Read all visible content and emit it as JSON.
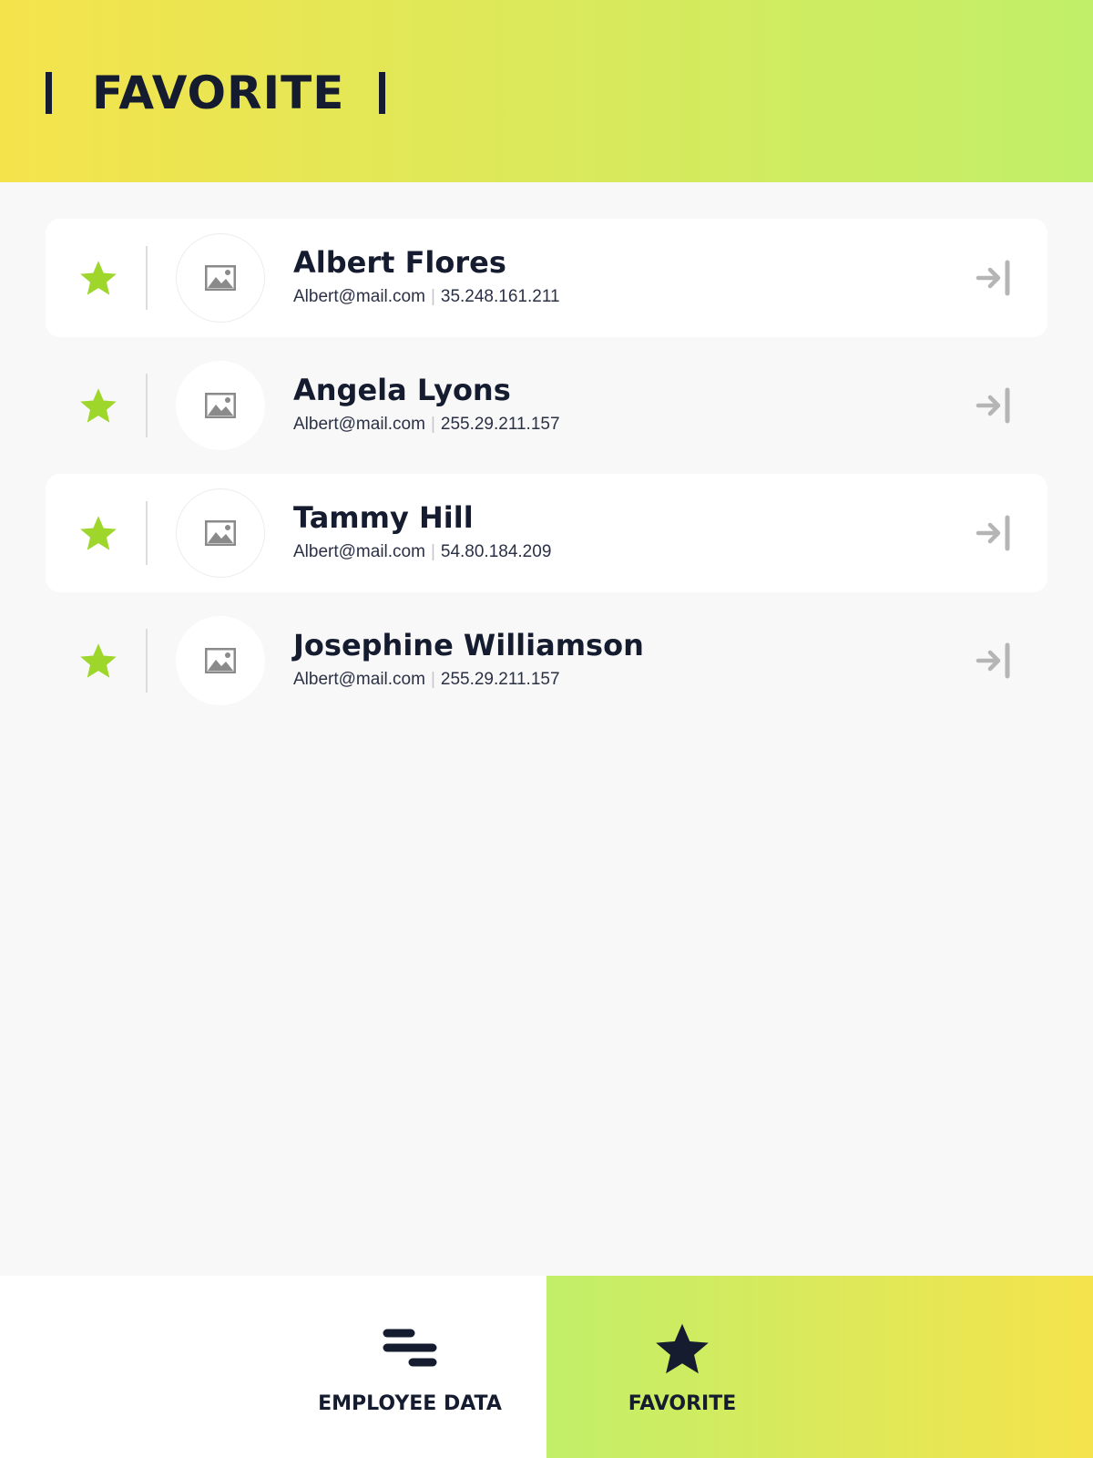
{
  "colors": {
    "accent_green": "#9ed62b",
    "dark_navy": "#151c2f",
    "header_gradient_start": "#f5e34c",
    "header_gradient_end": "#c1ef69",
    "muted_icon": "#b5b5b5"
  },
  "header": {
    "title": "FAVORITE"
  },
  "favorites": [
    {
      "name": "Albert Flores",
      "email": "Albert@mail.com",
      "ip": "35.248.161.211",
      "star_icon": "star-icon",
      "avatar_icon": "image-placeholder-icon",
      "action_icon": "arrow-right-to-bar-icon"
    },
    {
      "name": "Angela Lyons",
      "email": "Albert@mail.com",
      "ip": "255.29.211.157",
      "star_icon": "star-icon",
      "avatar_icon": "image-placeholder-icon",
      "action_icon": "arrow-right-to-bar-icon"
    },
    {
      "name": "Tammy Hill",
      "email": "Albert@mail.com",
      "ip": "54.80.184.209",
      "star_icon": "star-icon",
      "avatar_icon": "image-placeholder-icon",
      "action_icon": "arrow-right-to-bar-icon"
    },
    {
      "name": "Josephine Williamson",
      "email": "Albert@mail.com",
      "ip": "255.29.211.157",
      "star_icon": "star-icon",
      "avatar_icon": "image-placeholder-icon",
      "action_icon": "arrow-right-to-bar-icon"
    }
  ],
  "nav": {
    "employee_data": {
      "label": "EMPLOYEE DATA",
      "icon": "list-lines-icon"
    },
    "favorite": {
      "label": "FAVORITE",
      "icon": "star-icon",
      "active": true
    }
  }
}
